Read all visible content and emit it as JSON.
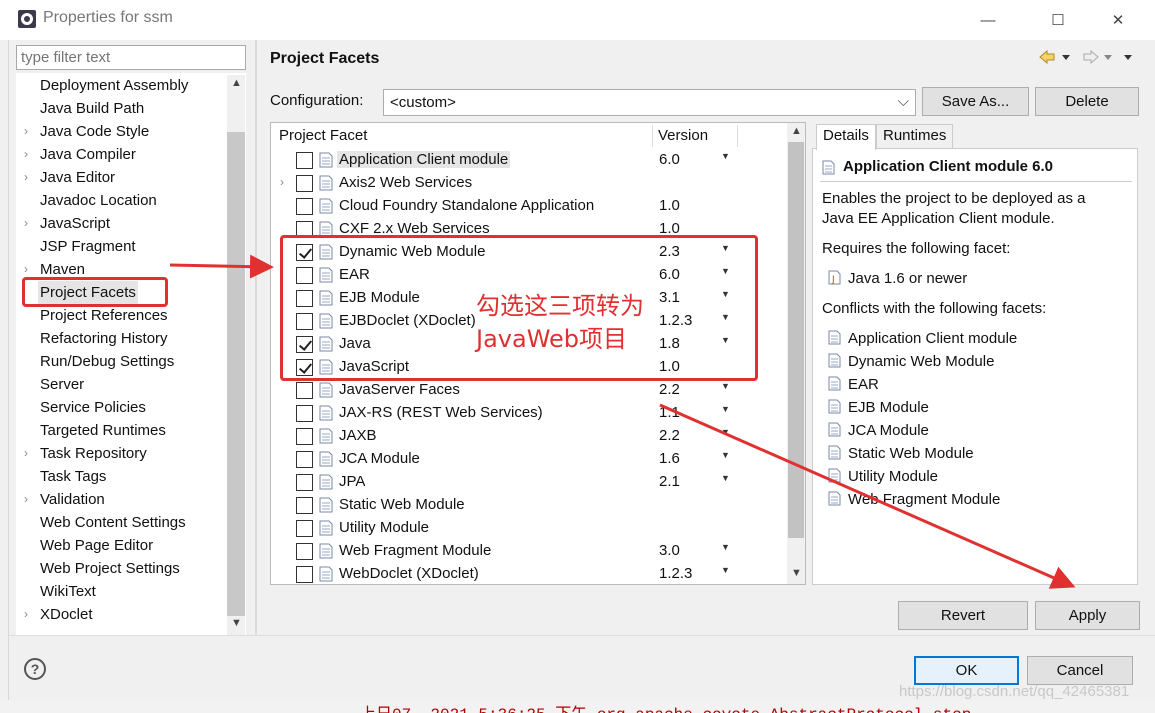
{
  "window": {
    "title": "Properties for ssm",
    "minimize": "—",
    "maximize": "☐",
    "close": "✕"
  },
  "filter": {
    "placeholder": "type filter text"
  },
  "nav": {
    "items": [
      {
        "label": "Deployment Assembly",
        "expandable": false
      },
      {
        "label": "Java Build Path",
        "expandable": false
      },
      {
        "label": "Java Code Style",
        "expandable": true
      },
      {
        "label": "Java Compiler",
        "expandable": true
      },
      {
        "label": "Java Editor",
        "expandable": true
      },
      {
        "label": "Javadoc Location",
        "expandable": false
      },
      {
        "label": "JavaScript",
        "expandable": true
      },
      {
        "label": "JSP Fragment",
        "expandable": false
      },
      {
        "label": "Maven",
        "expandable": true
      },
      {
        "label": "Project Facets",
        "expandable": false,
        "selected": true
      },
      {
        "label": "Project References",
        "expandable": false
      },
      {
        "label": "Refactoring History",
        "expandable": false
      },
      {
        "label": "Run/Debug Settings",
        "expandable": false
      },
      {
        "label": "Server",
        "expandable": false
      },
      {
        "label": "Service Policies",
        "expandable": false
      },
      {
        "label": "Targeted Runtimes",
        "expandable": false
      },
      {
        "label": "Task Repository",
        "expandable": true
      },
      {
        "label": "Task Tags",
        "expandable": false
      },
      {
        "label": "Validation",
        "expandable": true
      },
      {
        "label": "Web Content Settings",
        "expandable": false
      },
      {
        "label": "Web Page Editor",
        "expandable": false
      },
      {
        "label": "Web Project Settings",
        "expandable": false
      },
      {
        "label": "WikiText",
        "expandable": false
      },
      {
        "label": "XDoclet",
        "expandable": true
      }
    ]
  },
  "page": {
    "title": "Project Facets",
    "configuration_label": "Configuration:",
    "configuration_value": "<custom>",
    "save_as": "Save As...",
    "delete": "Delete"
  },
  "table": {
    "col_facet": "Project Facet",
    "col_version": "Version",
    "rows": [
      {
        "name": "Application Client module",
        "version": "6.0",
        "checked": false,
        "dropdown": true,
        "selected": true,
        "expandable": false
      },
      {
        "name": "Axis2 Web Services",
        "version": "",
        "checked": false,
        "dropdown": false,
        "expandable": true
      },
      {
        "name": "Cloud Foundry Standalone Application",
        "version": "1.0",
        "checked": false,
        "dropdown": false
      },
      {
        "name": "CXF 2.x Web Services",
        "version": "1.0",
        "checked": false,
        "dropdown": false
      },
      {
        "name": "Dynamic Web Module",
        "version": "2.3",
        "checked": true,
        "dropdown": true
      },
      {
        "name": "EAR",
        "version": "6.0",
        "checked": false,
        "dropdown": true
      },
      {
        "name": "EJB Module",
        "version": "3.1",
        "checked": false,
        "dropdown": true
      },
      {
        "name": "EJBDoclet (XDoclet)",
        "version": "1.2.3",
        "checked": false,
        "dropdown": true
      },
      {
        "name": "Java",
        "version": "1.8",
        "checked": true,
        "dropdown": true
      },
      {
        "name": "JavaScript",
        "version": "1.0",
        "checked": true,
        "dropdown": false
      },
      {
        "name": "JavaServer Faces",
        "version": "2.2",
        "checked": false,
        "dropdown": true
      },
      {
        "name": "JAX-RS (REST Web Services)",
        "version": "1.1",
        "checked": false,
        "dropdown": true
      },
      {
        "name": "JAXB",
        "version": "2.2",
        "checked": false,
        "dropdown": true
      },
      {
        "name": "JCA Module",
        "version": "1.6",
        "checked": false,
        "dropdown": true
      },
      {
        "name": "JPA",
        "version": "2.1",
        "checked": false,
        "dropdown": true
      },
      {
        "name": "Static Web Module",
        "version": "",
        "checked": false,
        "dropdown": false
      },
      {
        "name": "Utility Module",
        "version": "",
        "checked": false,
        "dropdown": false
      },
      {
        "name": "Web Fragment Module",
        "version": "3.0",
        "checked": false,
        "dropdown": true
      },
      {
        "name": "WebDoclet (XDoclet)",
        "version": "1.2.3",
        "checked": false,
        "dropdown": true
      }
    ]
  },
  "details": {
    "tab_details": "Details",
    "tab_runtimes": "Runtimes",
    "heading": "Application Client module 6.0",
    "description_line1": "Enables the project to be deployed as a",
    "description_line2": "Java EE Application Client module.",
    "requires_label": "Requires the following facet:",
    "requires": [
      "Java 1.6 or newer"
    ],
    "conflicts_label": "Conflicts with the following facets:",
    "conflicts": [
      "Application Client module",
      "Dynamic Web Module",
      "EAR",
      "EJB Module",
      "JCA Module",
      "Static Web Module",
      "Utility Module",
      "Web Fragment Module"
    ]
  },
  "buttons": {
    "revert": "Revert",
    "apply": "Apply",
    "ok": "OK",
    "cancel": "Cancel",
    "help": "?"
  },
  "annotation": {
    "line1": "勾选这三项转为",
    "line2": "JavaWeb项目",
    "color": "#e03030"
  },
  "watermark": "https://blog.csdn.net/qq_42465381",
  "underlay": {
    "console": "上日07, 2021 5:36:25 下午 org.apache.coyote.AbstractProtocol stop"
  }
}
